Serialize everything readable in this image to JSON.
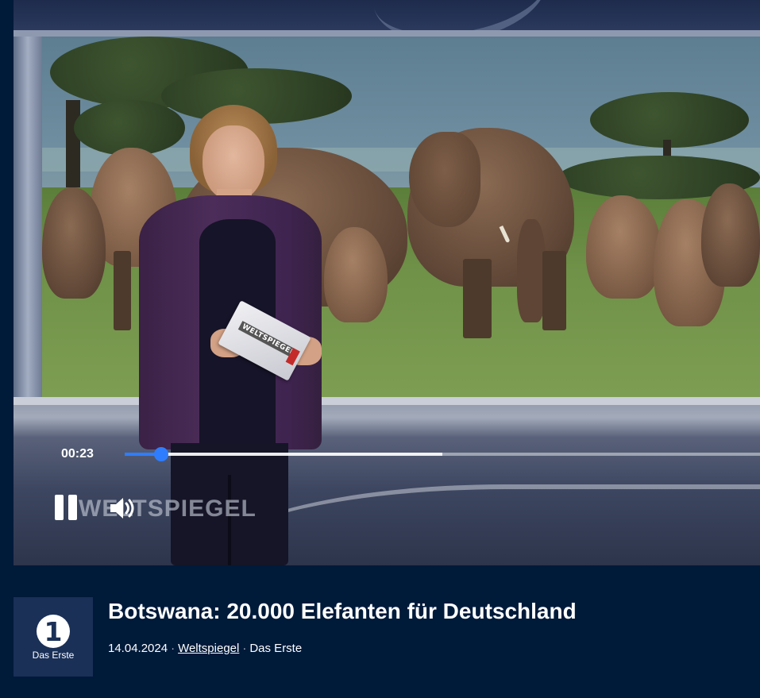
{
  "player": {
    "current_time": "00:23",
    "progress_fraction": 0.058,
    "buffered_fraction": 0.5,
    "state": "playing",
    "watermark": "WELTSPIEGEL",
    "card_text": "WELTSPIEGEL",
    "accent_color": "#2f7dff"
  },
  "info": {
    "title": "Botswana: 20.000 Elefanten für Deutschland",
    "date": "14.04.2024",
    "program": "Weltspiegel",
    "channel": "Das Erste",
    "separator": "·",
    "logo": {
      "mark": "1",
      "label": "Das Erste"
    }
  },
  "icons": {
    "pause": "pause-icon",
    "volume": "volume-icon",
    "channel_logo": "das-erste-logo-icon"
  },
  "colors": {
    "page_background": "#001a3a",
    "logo_tile": "#1a3057"
  }
}
